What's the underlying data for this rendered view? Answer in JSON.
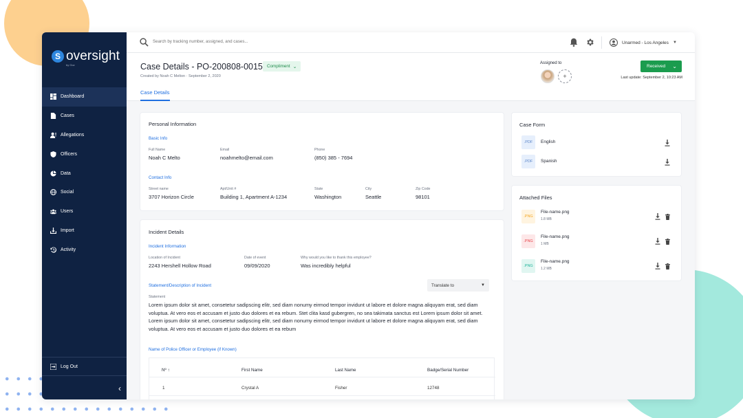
{
  "sidebar": {
    "brand": "oversight",
    "brand_sub": "by Gov",
    "items": [
      {
        "label": "Dashboard",
        "icon": "dashboard-icon"
      },
      {
        "label": "Cases",
        "icon": "document-icon"
      },
      {
        "label": "Allegations",
        "icon": "person-alert-icon"
      },
      {
        "label": "Officers",
        "icon": "shield-icon"
      },
      {
        "label": "Data",
        "icon": "pie-chart-icon"
      },
      {
        "label": "Social",
        "icon": "globe-icon"
      },
      {
        "label": "Users",
        "icon": "users-icon"
      },
      {
        "label": "Import",
        "icon": "import-icon"
      },
      {
        "label": "Activity",
        "icon": "history-icon"
      }
    ],
    "logout": "Log Out"
  },
  "topbar": {
    "search_placeholder": "Search by tracking number, assigned, and cases...",
    "user": "Unarmed - Los Angeles"
  },
  "header": {
    "title": "Case Details - PO-200808-00151",
    "category": "Compliment",
    "created": "Created by Noah C Melton  ·  September 2, 2020",
    "tab": "Case Details",
    "assigned_label": "Assigned to",
    "status": "Received",
    "last_update": "Last update: September 2, 10:23 AM"
  },
  "personal": {
    "title": "Personal Information",
    "basic_label": "Basic Info",
    "full_name_label": "Full Name",
    "full_name": "Noah C Melto",
    "email_label": "Email",
    "email": "noahmelto@email.com",
    "phone_label": "Phone",
    "phone": "(850) 385 - 7694",
    "contact_label": "Contact Info",
    "street_label": "Street name",
    "street": "3707  Horizon Circle",
    "apt_label": "Apt/Unit #",
    "apt": "Building 1, Apartment  A-1234",
    "state_label": "State",
    "state": "Washington",
    "city_label": "City",
    "city": "Seattle",
    "zip_label": "Zip Code",
    "zip": "98101"
  },
  "incident": {
    "title": "Incident Details",
    "info_label": "Incident Information",
    "location_label": "Location of Incident",
    "location": "2243  Hershell Hollow Road",
    "date_label": "Date of event",
    "date": "09/09/2020",
    "thank_label": "Why would you like to thank this employee?",
    "thank": "Was incredibly helpful",
    "statement_section": "Statement/Description of Incident",
    "translate": "Translate to",
    "statement_label": "Statement",
    "statement": "Lorem ipsum dolor sit amet, consetetur sadipscing elitr, sed diam nonumy eirmod tempor invidunt ut labore et dolore magna aliquyam erat, sed diam voluptua. At vero eos et accusam et justo duo dolores et ea rebum. Stet clita kasd gubergren, no sea takimata sanctus est Lorem ipsum dolor sit amet. Lorem ipsum dolor sit amet, consetetur sadipscing elitr, sed diam nonumy eirmod tempor invidunt ut labore et dolore magna aliquyam erat, sed diam voluptua. At vero eos et accusam et justo duo dolores et ea rebum",
    "officer_section": "Name of Police Officer or Employee (if Known)",
    "table": {
      "headers": [
        "Nº ↑",
        "First Name",
        "Last Name",
        "Badge/Serial Number"
      ],
      "rows": [
        [
          "1",
          "Crystal A",
          "Fisher",
          "12748"
        ]
      ]
    }
  },
  "case_form": {
    "title": "Case Form",
    "files": [
      {
        "type": ".PDF",
        "name": "English"
      },
      {
        "type": ".PDF",
        "name": "Spanish"
      }
    ]
  },
  "attached": {
    "title": "Attached Files",
    "files": [
      {
        "type": ".PNG",
        "name": "File-name.png",
        "size": "1.8 MB",
        "color": "#f4a623",
        "bg": "#fff4e0"
      },
      {
        "type": ".PNG",
        "name": "File-name.png",
        "size": "1 MB",
        "color": "#e8454a",
        "bg": "#fde7e8"
      },
      {
        "type": ".PNG",
        "name": "File-name.png",
        "size": "1.2 MB",
        "color": "#1fb39a",
        "bg": "#e0f6f1"
      }
    ]
  },
  "colors": {
    "sidebar": "#0f2242",
    "accent": "#1f6fe0",
    "status": "#1b9c4e"
  }
}
